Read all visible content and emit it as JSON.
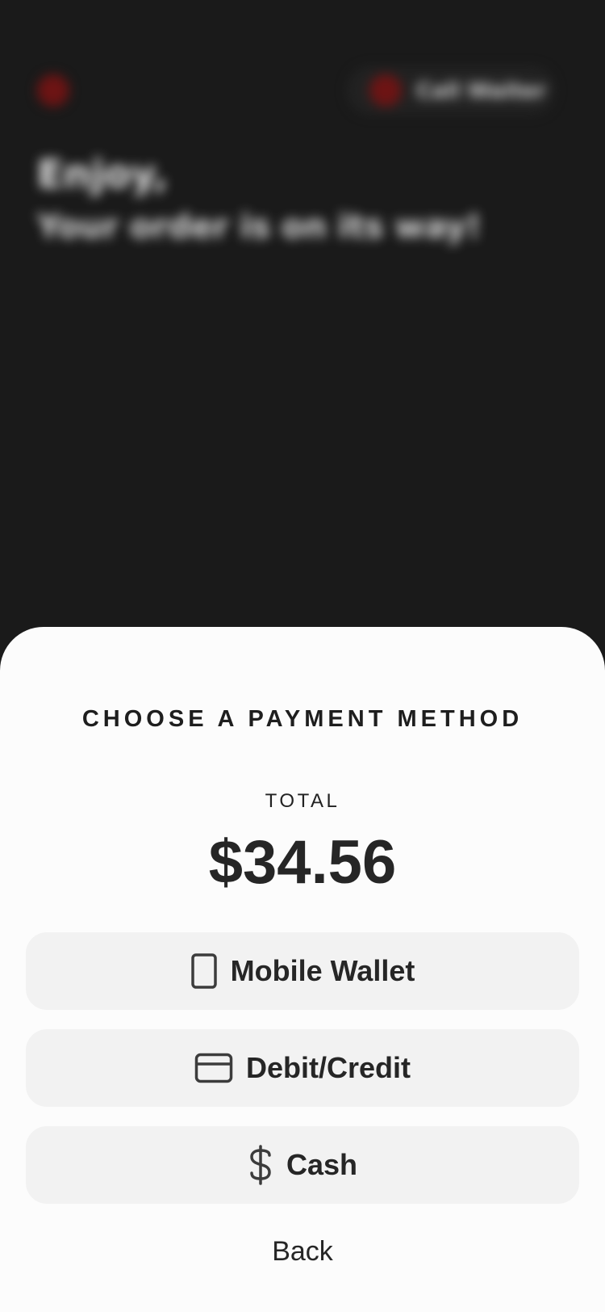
{
  "background": {
    "header_pill_text": "Call Waiter",
    "title": "Enjoy,",
    "subtitle": "Your order is on its way!"
  },
  "sheet": {
    "title": "CHOOSE A PAYMENT METHOD",
    "total_label": "TOTAL",
    "total_amount": "$34.56",
    "methods": [
      {
        "label": "Mobile Wallet",
        "icon": "phone-icon"
      },
      {
        "label": "Debit/Credit",
        "icon": "credit-card-icon"
      },
      {
        "label": "Cash",
        "icon": "dollar-icon"
      }
    ],
    "back_label": "Back"
  },
  "colors": {
    "background": "#1a1a1a",
    "sheet": "#fcfcfc",
    "button": "#f2f2f2",
    "text": "#262626",
    "accent": "#6d1414"
  }
}
